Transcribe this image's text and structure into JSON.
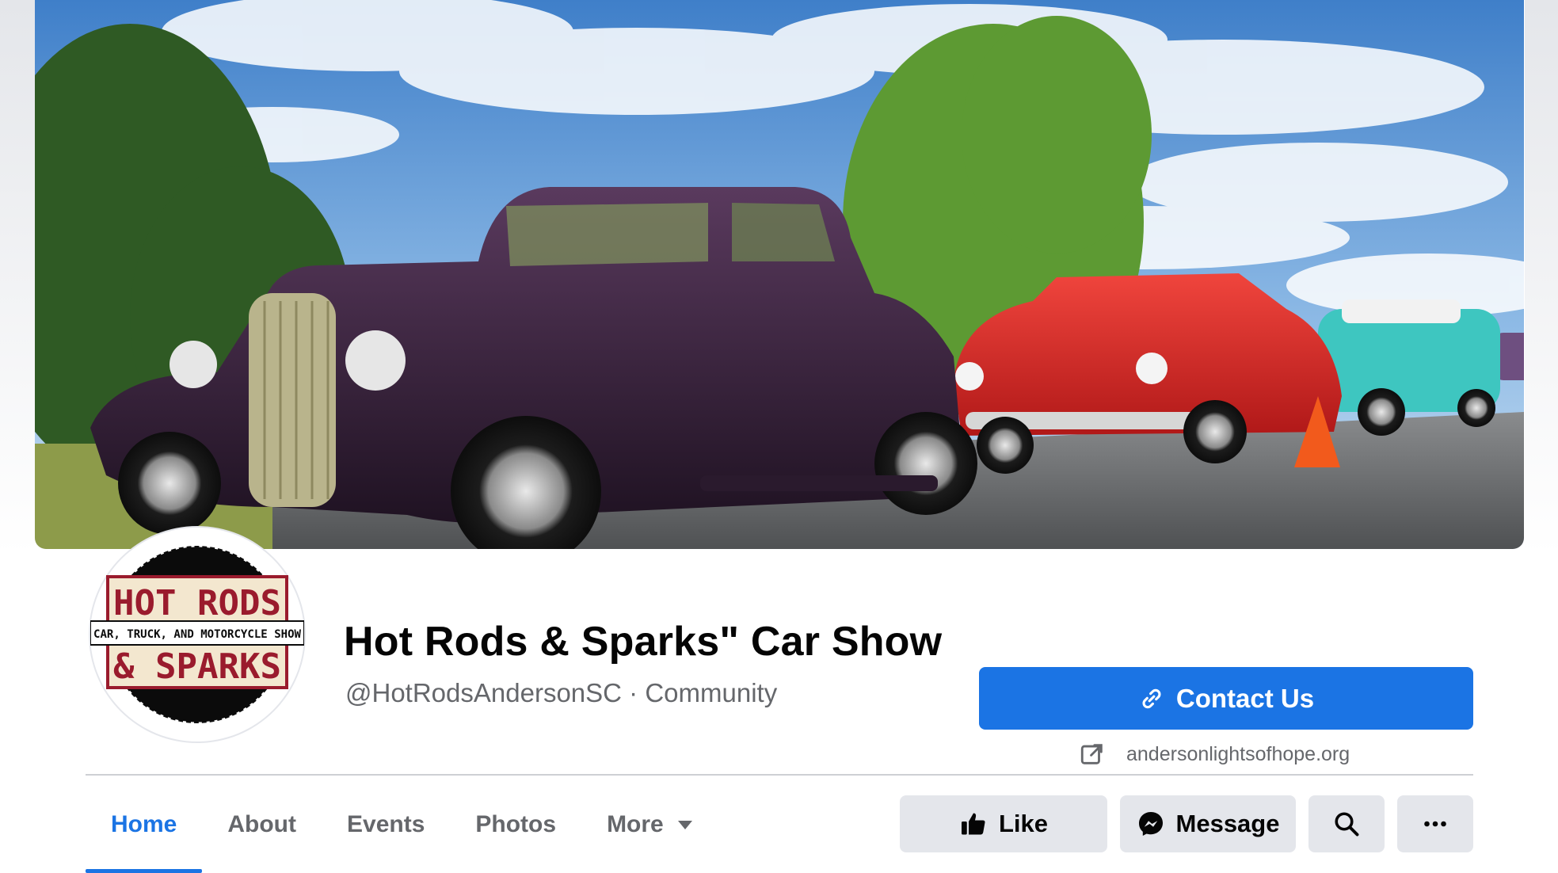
{
  "page": {
    "title": "Hot Rods & Sparks\" Car Show",
    "handle": "@HotRodsAndersonSC · Community",
    "website": "andersonlightsofhope.org"
  },
  "logo": {
    "line1": "HOT RODS",
    "line2": "CAR, TRUCK, AND MOTORCYCLE SHOW",
    "line3": "& SPARKS"
  },
  "buttons": {
    "contact_label": "Contact Us",
    "like_label": "Like",
    "message_label": "Message"
  },
  "tabs": [
    {
      "label": "Home",
      "active": true
    },
    {
      "label": "About",
      "active": false
    },
    {
      "label": "Events",
      "active": false
    },
    {
      "label": "Photos",
      "active": false
    },
    {
      "label": "More",
      "active": false
    }
  ],
  "icons": {
    "contact": "link-icon",
    "website": "external-link-icon",
    "like": "thumbs-up-icon",
    "message": "messenger-icon",
    "search": "search-icon",
    "more": "ellipsis-icon",
    "more_tab": "caret-down-icon"
  },
  "colors": {
    "accent": "#1b74e4",
    "secondary_button": "#e4e6eb",
    "muted_text": "#65676b"
  }
}
